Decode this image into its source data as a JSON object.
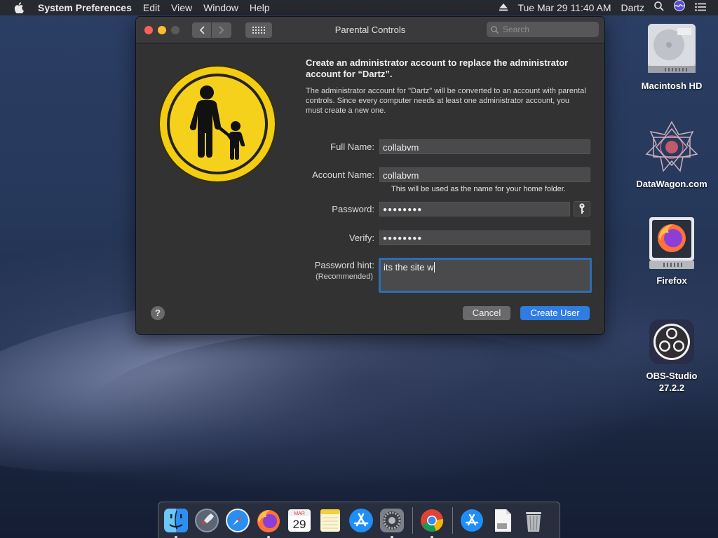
{
  "menubar": {
    "app_name": "System Preferences",
    "menus": [
      "Edit",
      "View",
      "Window",
      "Help"
    ],
    "datetime": "Tue Mar 29  11:40 AM",
    "user": "Dartz"
  },
  "window": {
    "title": "Parental Controls",
    "search_placeholder": "Search"
  },
  "dialog": {
    "heading": "Create an administrator account to replace the administrator account for “Dartz”.",
    "description": "The administrator account for \"Dartz\" will be converted to an account with parental controls. Since every computer needs at least one administrator account, you must create a new one.",
    "full_name_label": "Full Name:",
    "full_name_value": "collabvm",
    "account_name_label": "Account Name:",
    "account_name_value": "collabvm",
    "home_folder_note": "This will be used as the name for your home folder.",
    "password_label": "Password:",
    "password_value": "●●●●●●●●",
    "verify_label": "Verify:",
    "verify_value": "●●●●●●●●",
    "hint_label": "Password hint:",
    "hint_sublabel": "(Recommended)",
    "hint_value": "its the site w",
    "help_label": "?",
    "cancel_label": "Cancel",
    "create_label": "Create User"
  },
  "desktop_icons": [
    {
      "label": "Macintosh HD",
      "icon": "hard-drive-icon"
    },
    {
      "label": "DataWagon.com",
      "icon": "datawagon-icon"
    },
    {
      "label": "Firefox",
      "icon": "firefox-disk-icon"
    },
    {
      "label": "OBS-Studio 27.2.2",
      "icon": "obs-icon"
    }
  ],
  "dock": {
    "calendar_month": "MAR",
    "calendar_day": "29",
    "items": [
      "finder-icon",
      "launchpad-icon",
      "safari-icon",
      "firefox-icon",
      "calendar-icon",
      "notes-icon",
      "app-store-icon",
      "system-preferences-icon",
      "chrome-icon",
      "app-store-download-icon",
      "document-icon",
      "trash-icon"
    ]
  },
  "colors": {
    "accent": "#2f7de1",
    "close": "#fe5f57",
    "minimize": "#febc2e",
    "parental_yellow": "#f6d11c"
  }
}
